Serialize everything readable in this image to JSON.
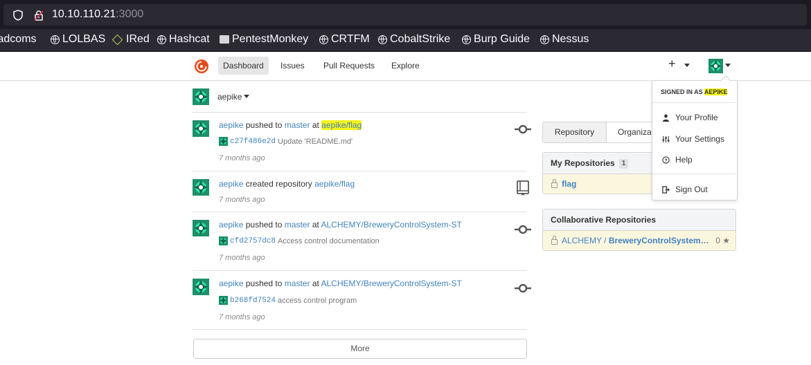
{
  "browser": {
    "url_host": "10.10.110.21",
    "url_port": ":3000",
    "bookmarks": [
      "Wadcoms",
      "LOLBAS",
      "IRed",
      "Hashcat",
      "PentestMonkey",
      "CRTFM",
      "CobaltStrike",
      "Burp Guide",
      "Nessus"
    ]
  },
  "nav": {
    "dashboard": "Dashboard",
    "issues": "Issues",
    "pull_requests": "Pull Requests",
    "explore": "Explore",
    "plus": "+"
  },
  "context": {
    "username": "aepike"
  },
  "feed": [
    {
      "user": "aepike",
      "action": "pushed to",
      "branch": "master",
      "at": "at",
      "repo": "aepike/flag",
      "sha": "c27f486e2d",
      "message": "Update 'README.md'",
      "time": "7 months ago"
    },
    {
      "user": "aepike",
      "action": "created repository",
      "repo": "aepike/flag",
      "time": "7 months ago"
    },
    {
      "user": "aepike",
      "action": "pushed to",
      "branch": "master",
      "at": "at",
      "repo": "ALCHEMY/BreweryControlSystem-ST",
      "sha": "cfd2757dc8",
      "message": "Access control documentation",
      "time": "7 months ago"
    },
    {
      "user": "aepike",
      "action": "pushed to",
      "branch": "master",
      "at": "at",
      "repo": "ALCHEMY/BreweryControlSystem-ST",
      "sha": "b268fd7524",
      "message": "access control program",
      "time": "7 months ago"
    }
  ],
  "more_label": "More",
  "right": {
    "tab_repository": "Repository",
    "tab_organization": "Organizat",
    "my_repos_title": "My Repositories",
    "my_repos_count": "1",
    "my_repo": "flag",
    "collab_title": "Collaborative Repositories",
    "collab_owner": "ALCHEMY",
    "collab_slash": "/",
    "collab_repo": "BreweryControlSystem…",
    "collab_stars": "0 ★"
  },
  "dropdown": {
    "signed_in_as": "SIGNED IN AS",
    "user": "AEPIKE",
    "profile": "Your Profile",
    "settings": "Your Settings",
    "help": "Help",
    "signout": "Sign Out"
  }
}
